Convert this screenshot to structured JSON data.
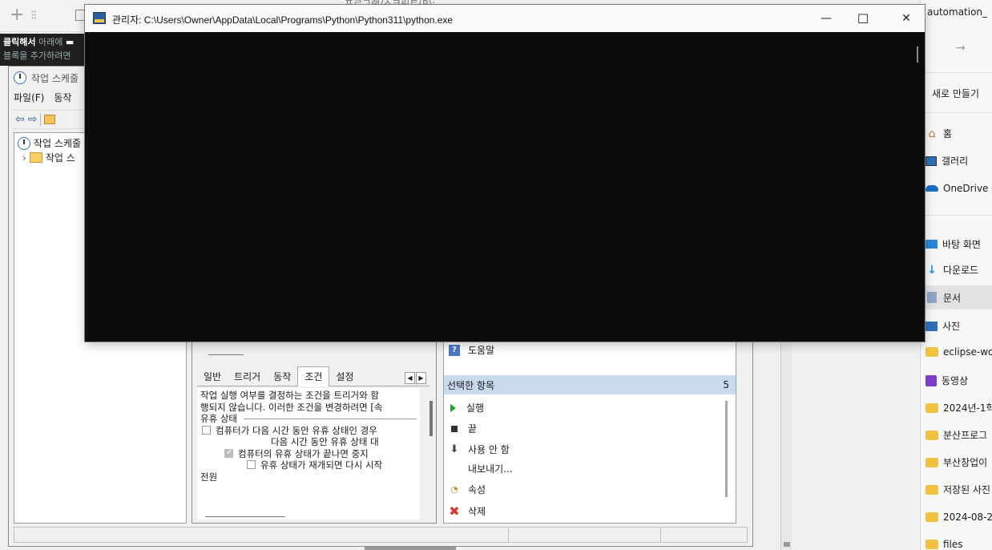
{
  "background": {
    "partial_top_text": "프로그램/스크립트(P):"
  },
  "hint": {
    "line1_bold": "클릭해서",
    "line1_rest": " 아래에",
    "line2": "블록을 추가하려면"
  },
  "scheduler": {
    "title": "작업 스케줄",
    "menu": [
      "파일(F)",
      "동작"
    ],
    "tree": [
      "작업 스케줄",
      "작업 스"
    ],
    "tabs": [
      "일반",
      "트리거",
      "동작",
      "조건",
      "설정"
    ],
    "active_tab": "조건",
    "conditions": {
      "intro1": "작업 실행 여부를 결정하는 조건을 트리거와 함",
      "intro2": "행되지 않습니다. 이러한 조건을 변경하려면 [속",
      "idle_heading": "유휴 상태",
      "idle_start": "컴퓨터가 다음 시간 동안 유휴 상태인 경우",
      "idle_wait": "다음 시간 동안 유휴 상태 대",
      "idle_stop": "컴퓨터의 유휴 상태가 끝나면 중지",
      "idle_restart": "유휴 상태가 재개되면 다시 시작",
      "power_heading": "전원"
    },
    "actions": {
      "help": "도움말",
      "selected_header": "선택한 항목",
      "selected_count": "5",
      "run": "실행",
      "end": "끝",
      "disable": "사용 안 함",
      "export": "내보내기...",
      "properties": "속성",
      "delete": "삭제"
    }
  },
  "console": {
    "title": "관리자: C:\\Users\\Owner\\AppData\\Local\\Programs\\Python\\Python311\\python.exe",
    "minimize": "—",
    "maximize": "☐",
    "close": "✕"
  },
  "explorer": {
    "title": "automation_",
    "new_label": "새로 만들기",
    "nav": [
      {
        "label": "홈",
        "icon": "home-icon"
      },
      {
        "label": "갤러리",
        "icon": "gallery-icon"
      },
      {
        "label": "OneDrive -",
        "icon": "cloud-icon"
      },
      {
        "label": "바탕 화면",
        "icon": "desktop-icon"
      },
      {
        "label": "다운로드",
        "icon": "download-icon"
      },
      {
        "label": "문서",
        "icon": "document-icon"
      },
      {
        "label": "사진",
        "icon": "pictures-icon"
      },
      {
        "label": "eclipse-wo",
        "icon": "folder-icon"
      },
      {
        "label": "동영상",
        "icon": "video-icon"
      },
      {
        "label": "2024년-1학",
        "icon": "folder-icon"
      },
      {
        "label": "분산프로그",
        "icon": "folder-icon"
      },
      {
        "label": "부산창업이",
        "icon": "folder-icon"
      },
      {
        "label": "저장된 사진",
        "icon": "folder-icon"
      },
      {
        "label": "2024-08-2",
        "icon": "folder-icon"
      },
      {
        "label": "files",
        "icon": "folder-icon"
      }
    ],
    "selected": "문서"
  }
}
